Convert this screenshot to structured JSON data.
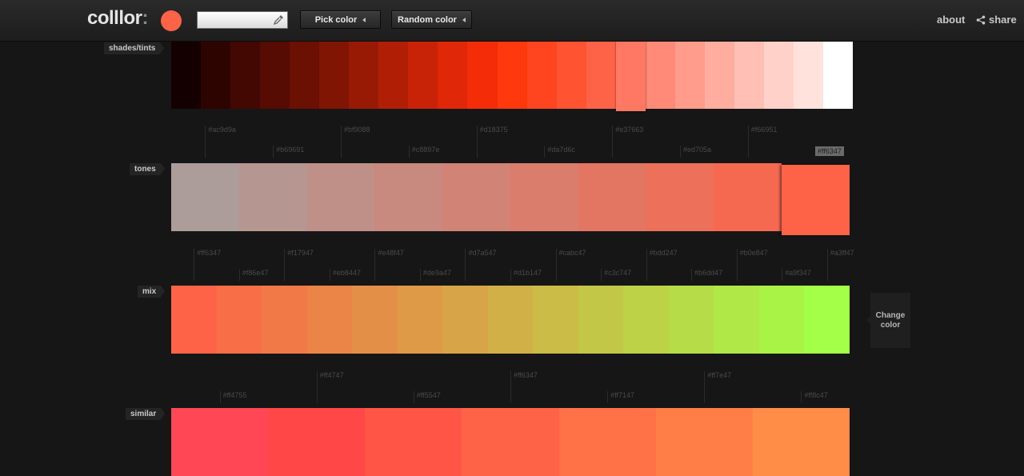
{
  "header": {
    "logo": "colllor",
    "logo_colon": ":",
    "current_color": "#ff6347",
    "hex_input_value": "",
    "pick_color_label": "Pick color",
    "random_color_label": "Random color",
    "about_label": "about",
    "share_label": "share"
  },
  "sections": {
    "shades": {
      "label": "shades/tints",
      "colors": [
        "#140000",
        "#2e0401",
        "#420801",
        "#560c02",
        "#6b1003",
        "#801504",
        "#981a05",
        "#b01f05",
        "#c82306",
        "#e02707",
        "#f52c08",
        "#ff380d",
        "#ff4520",
        "#ff5332",
        "#ff6347",
        "#ff7863",
        "#ff8a77",
        "#ff9c8b",
        "#ffad9f",
        "#ffbfb4",
        "#ffd1c8",
        "#ffe2dc",
        "#ffffff"
      ],
      "selected_index": 15
    },
    "tones": {
      "label": "tones",
      "colors": [
        "#ac9d9a",
        "#b69691",
        "#bf9088",
        "#c8897e",
        "#d18375",
        "#da7d6c",
        "#e37663",
        "#ed705a",
        "#f66951",
        "#ff6347"
      ],
      "selected_index": 9,
      "selected_hex": "#ff6347",
      "hex_top": [
        "#ac9d9a",
        "#bf9088",
        "#d18375",
        "#e37663",
        "#f66951"
      ],
      "hex_bottom": [
        "#b69691",
        "#c8897e",
        "#da7d6c",
        "#ed705a"
      ]
    },
    "mix": {
      "label": "mix",
      "colors": [
        "#ff6347",
        "#f86e47",
        "#f17947",
        "#eb8447",
        "#e48f47",
        "#de9a47",
        "#d7a547",
        "#d1b147",
        "#cabc47",
        "#c3c747",
        "#bdd247",
        "#b6dd47",
        "#b0e847",
        "#a9f347",
        "#a3ff47"
      ],
      "hex_top": [
        "#ff6347",
        "#f17947",
        "#e48f47",
        "#d7a547",
        "#cabc47",
        "#bdd247",
        "#b0e847",
        "#a3ff47"
      ],
      "hex_bottom": [
        "#f86e47",
        "#eb8447",
        "#de9a47",
        "#d1b147",
        "#c3c747",
        "#b6dd47",
        "#a9f347"
      ],
      "change_color_label": "Change color"
    },
    "similar": {
      "label": "similar",
      "colors": [
        "#ff4755",
        "#ff4747",
        "#ff5547",
        "#ff6347",
        "#ff7147",
        "#ff7e47",
        "#ff8c47"
      ],
      "hex_top": [
        "#ff4747",
        "#ff6347",
        "#ff7e47"
      ],
      "hex_bottom": [
        "#ff4755",
        "#ff5547",
        "#ff7147",
        "#ff8c47"
      ]
    }
  }
}
